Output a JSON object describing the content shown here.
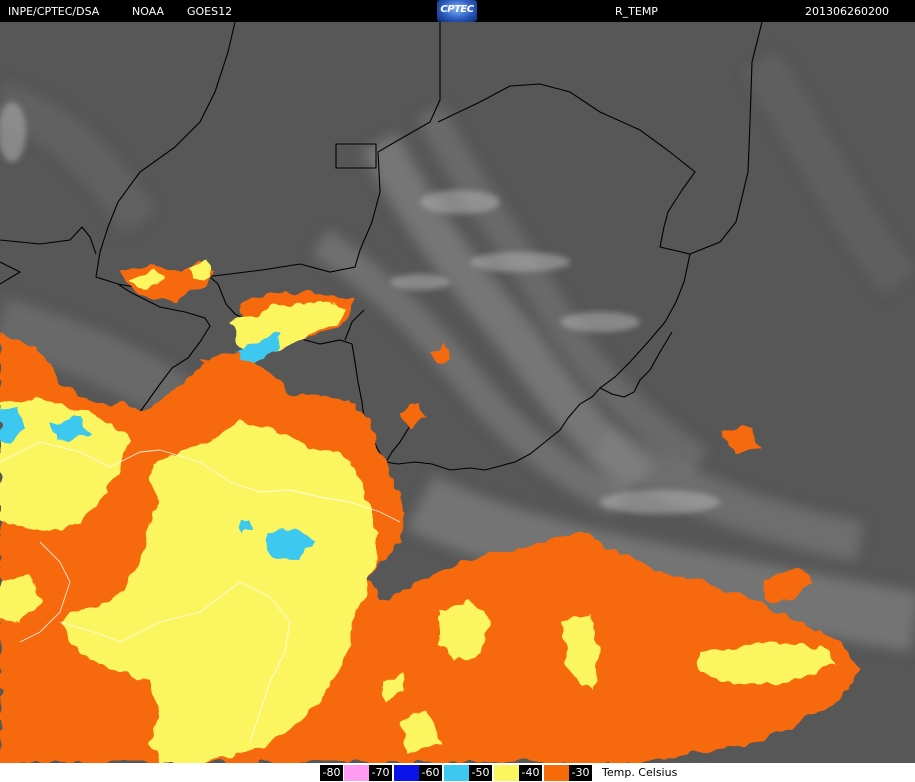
{
  "header": {
    "agency": "INPE/CPTEC/DSA",
    "provider": "NOAA",
    "satellite": "GOES12",
    "logo_text": "CPTEC",
    "product": "R_TEMP",
    "timestamp": "201306260200"
  },
  "legend": {
    "items": [
      {
        "label": "-80",
        "color": "#000000",
        "text_color": "#ffffff"
      },
      {
        "label": "-70",
        "color": "#ff9cf2",
        "text_color": "#000000"
      },
      {
        "label": "-60",
        "color": "#0a14e8",
        "text_color": "#ffffff"
      },
      {
        "label": "-50",
        "color": "#3cc8f0",
        "text_color": "#000000"
      },
      {
        "label": "-40",
        "color": "#fbf560",
        "text_color": "#000000"
      },
      {
        "label": "-30",
        "color": "#f66a0a",
        "text_color": "#000000"
      }
    ],
    "unit_label": "Temp. Celsius"
  },
  "colors": {
    "background_gray": "#575757",
    "cloud_gray": "#8e8e8e",
    "border_line": "#000000",
    "orange": "#f66a0a",
    "yellow": "#fbf560",
    "cyan": "#3cc8f0"
  }
}
